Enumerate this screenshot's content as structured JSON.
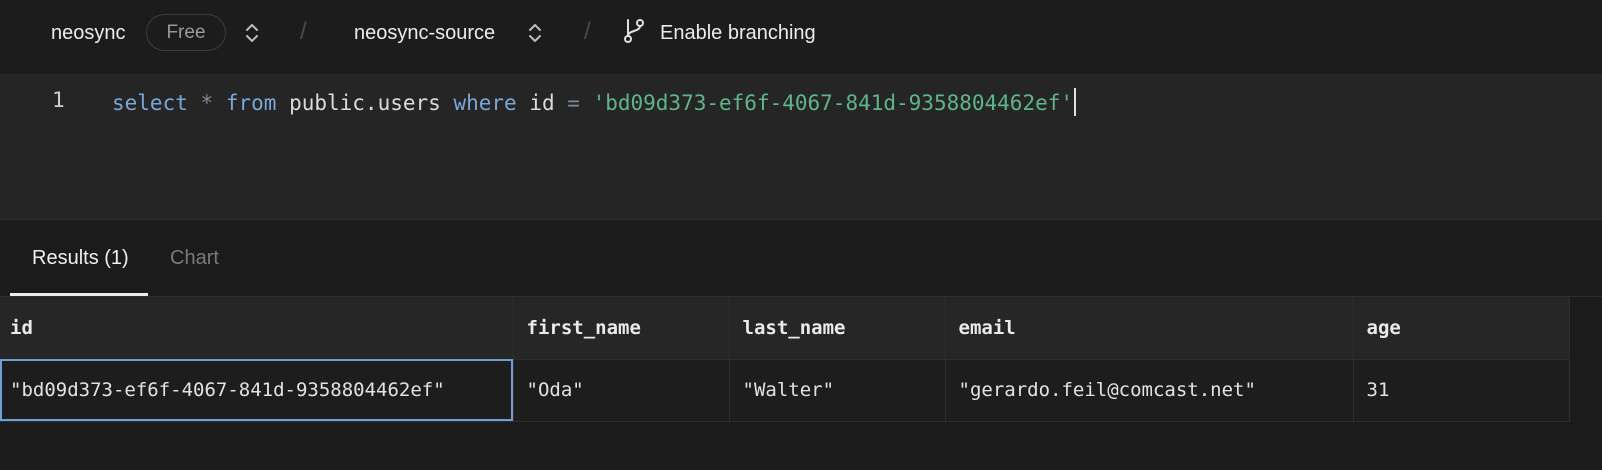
{
  "topbar": {
    "project_name": "neosync",
    "plan_badge": "Free",
    "separator": "/",
    "branch_name": "neosync-source",
    "enable_branching_label": "Enable branching"
  },
  "editor": {
    "line_number": "1",
    "tokens": {
      "select": "select",
      "star": "*",
      "from": "from",
      "table": "public.users",
      "where": "where",
      "column": "id",
      "equals": "=",
      "value": "'bd09d373-ef6f-4067-841d-9358804462ef'"
    }
  },
  "results": {
    "tabs": [
      {
        "label": "Results (1)",
        "active": true
      },
      {
        "label": "Chart",
        "active": false
      }
    ],
    "columns": [
      "id",
      "first_name",
      "last_name",
      "email",
      "age"
    ],
    "rows": [
      [
        "\"bd09d373-ef6f-4067-841d-9358804462ef\"",
        "\"Oda\"",
        "\"Walter\"",
        "\"gerardo.feil@comcast.net\"",
        "31"
      ]
    ]
  },
  "colors": {
    "keyword": "#7aa6d9",
    "string": "#5fb58a",
    "selection_outline": "#6e9fd6",
    "background": "#1b1b1b"
  },
  "icons": [
    "chevron-up-down-icon",
    "git-branch-icon"
  ]
}
